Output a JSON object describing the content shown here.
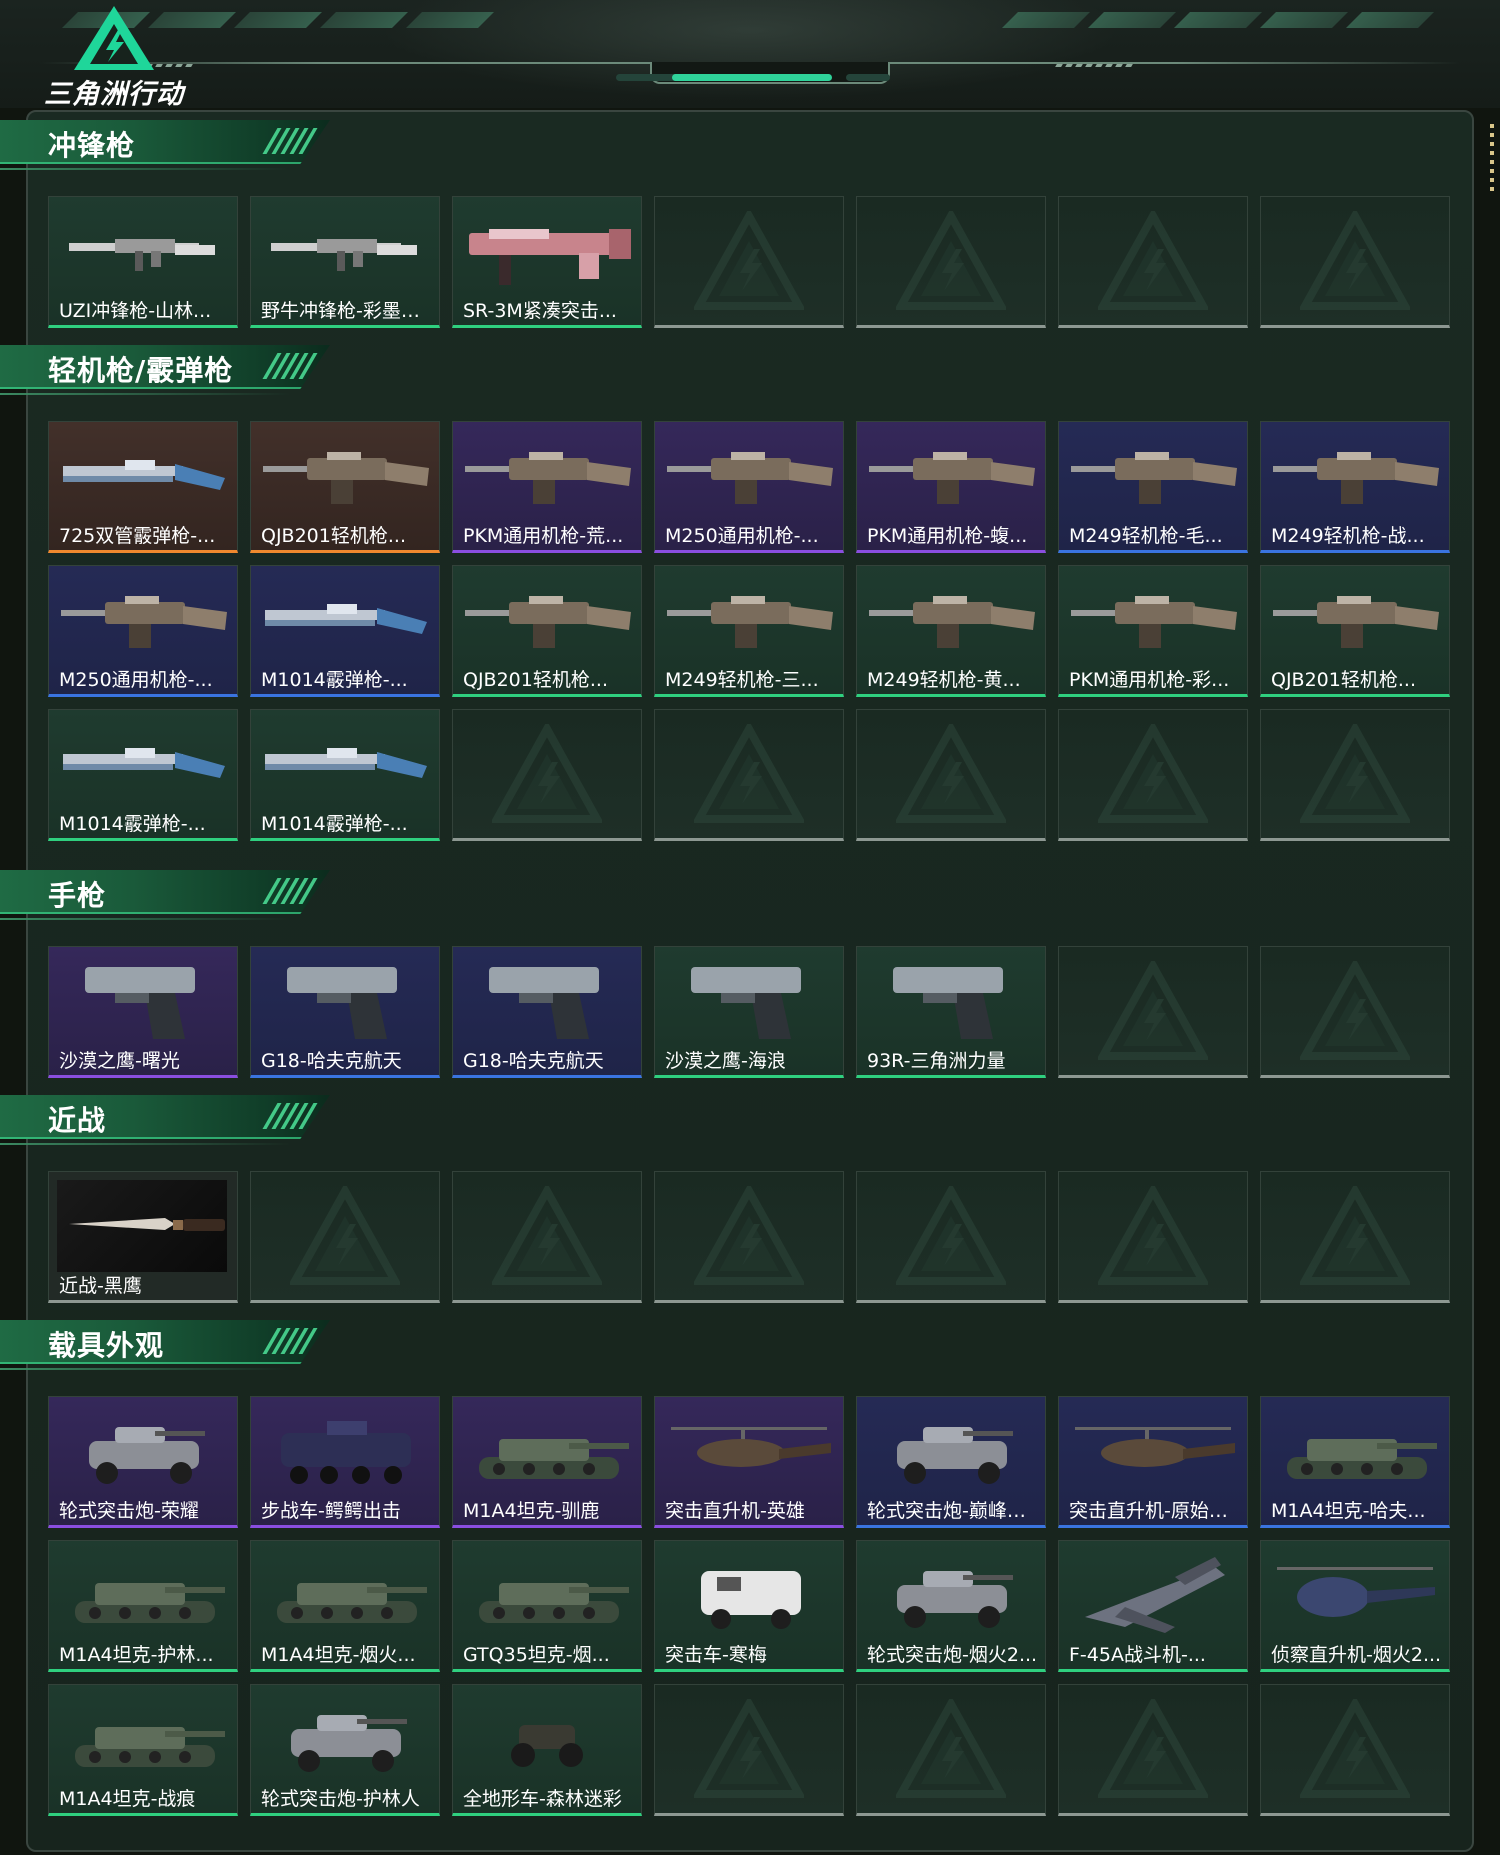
{
  "app": {
    "logo_text": "三角洲行动"
  },
  "colors": {
    "green": "#2fd07f",
    "blue": "#3a74e0",
    "purple": "#8a4ee0",
    "orange": "#f0882e",
    "empty": "#8d9892"
  },
  "sections": [
    {
      "title": "冲锋枪",
      "items": [
        {
          "label": "UZI冲锋枪-山林...",
          "rarity": "green",
          "kind": "smg"
        },
        {
          "label": "野牛冲锋枪-彩墨喷...",
          "rarity": "green",
          "kind": "smg"
        },
        {
          "label": "SR-3M紧凑突击...",
          "rarity": "green",
          "kind": "rifle"
        },
        {
          "label": "",
          "rarity": "empty"
        },
        {
          "label": "",
          "rarity": "empty"
        },
        {
          "label": "",
          "rarity": "empty"
        },
        {
          "label": "",
          "rarity": "empty"
        }
      ]
    },
    {
      "title": "轻机枪/霰弹枪",
      "items": [
        {
          "label": "725双管霰弹枪-...",
          "rarity": "orange",
          "kind": "shotgun"
        },
        {
          "label": "QJB201轻机枪...",
          "rarity": "orange",
          "kind": "lmg"
        },
        {
          "label": "PKM通用机枪-荒...",
          "rarity": "purple",
          "kind": "lmg"
        },
        {
          "label": "M250通用机枪-...",
          "rarity": "purple",
          "kind": "lmg"
        },
        {
          "label": "PKM通用机枪-蝮...",
          "rarity": "purple",
          "kind": "lmg"
        },
        {
          "label": "M249轻机枪-毛...",
          "rarity": "blue",
          "kind": "lmg"
        },
        {
          "label": "M249轻机枪-战...",
          "rarity": "blue",
          "kind": "lmg"
        },
        {
          "label": "M250通用机枪-...",
          "rarity": "blue",
          "kind": "lmg"
        },
        {
          "label": "M1014霰弹枪-...",
          "rarity": "blue",
          "kind": "shotgun"
        },
        {
          "label": "QJB201轻机枪...",
          "rarity": "green",
          "kind": "lmg"
        },
        {
          "label": "M249轻机枪-三...",
          "rarity": "green",
          "kind": "lmg"
        },
        {
          "label": "M249轻机枪-黄...",
          "rarity": "green",
          "kind": "lmg"
        },
        {
          "label": "PKM通用机枪-彩...",
          "rarity": "green",
          "kind": "lmg"
        },
        {
          "label": "QJB201轻机枪...",
          "rarity": "green",
          "kind": "lmg"
        },
        {
          "label": "M1014霰弹枪-...",
          "rarity": "green",
          "kind": "shotgun"
        },
        {
          "label": "M1014霰弹枪-...",
          "rarity": "green",
          "kind": "shotgun"
        },
        {
          "label": "",
          "rarity": "empty"
        },
        {
          "label": "",
          "rarity": "empty"
        },
        {
          "label": "",
          "rarity": "empty"
        },
        {
          "label": "",
          "rarity": "empty"
        },
        {
          "label": "",
          "rarity": "empty"
        }
      ]
    },
    {
      "title": "手枪",
      "items": [
        {
          "label": "沙漠之鹰-曙光",
          "rarity": "purple",
          "kind": "pistol"
        },
        {
          "label": "G18-哈夫克航天",
          "rarity": "blue",
          "kind": "pistol"
        },
        {
          "label": "G18-哈夫克航天",
          "rarity": "blue",
          "kind": "pistol"
        },
        {
          "label": "沙漠之鹰-海浪",
          "rarity": "green",
          "kind": "pistol"
        },
        {
          "label": "93R-三角洲力量",
          "rarity": "green",
          "kind": "pistol"
        },
        {
          "label": "",
          "rarity": "empty"
        },
        {
          "label": "",
          "rarity": "empty"
        }
      ]
    },
    {
      "title": "近战",
      "items": [
        {
          "label": "近战-黑鹰",
          "rarity": "melee",
          "kind": "knife"
        },
        {
          "label": "",
          "rarity": "empty"
        },
        {
          "label": "",
          "rarity": "empty"
        },
        {
          "label": "",
          "rarity": "empty"
        },
        {
          "label": "",
          "rarity": "empty"
        },
        {
          "label": "",
          "rarity": "empty"
        },
        {
          "label": "",
          "rarity": "empty"
        }
      ]
    },
    {
      "title": "载具外观",
      "items": [
        {
          "label": "轮式突击炮-荣耀",
          "rarity": "purple",
          "kind": "wheeled"
        },
        {
          "label": "步战车-鳄鳄出击",
          "rarity": "purple",
          "kind": "apc"
        },
        {
          "label": "M1A4坦克-驯鹿",
          "rarity": "purple",
          "kind": "tank"
        },
        {
          "label": "突击直升机-英雄",
          "rarity": "purple",
          "kind": "heli"
        },
        {
          "label": "轮式突击炮-巅峰竞...",
          "rarity": "blue",
          "kind": "wheeled"
        },
        {
          "label": "突击直升机-原始伪...",
          "rarity": "blue",
          "kind": "heli"
        },
        {
          "label": "M1A4坦克-哈夫...",
          "rarity": "blue",
          "kind": "tank"
        },
        {
          "label": "M1A4坦克-护林...",
          "rarity": "green",
          "kind": "tank"
        },
        {
          "label": "M1A4坦克-烟火...",
          "rarity": "green",
          "kind": "tank"
        },
        {
          "label": "GTQ35坦克-烟...",
          "rarity": "green",
          "kind": "tank"
        },
        {
          "label": "突击车-寒梅",
          "rarity": "green",
          "kind": "truck"
        },
        {
          "label": "轮式突击炮-烟火2...",
          "rarity": "green",
          "kind": "wheeled"
        },
        {
          "label": "F-45A战斗机-...",
          "rarity": "green",
          "kind": "jet"
        },
        {
          "label": "侦察直升机-烟火2...",
          "rarity": "green",
          "kind": "heli2"
        },
        {
          "label": "M1A4坦克-战痕",
          "rarity": "green",
          "kind": "tank"
        },
        {
          "label": "轮式突击炮-护林人",
          "rarity": "green",
          "kind": "wheeled"
        },
        {
          "label": "全地形车-森林迷彩",
          "rarity": "green",
          "kind": "atv"
        },
        {
          "label": "",
          "rarity": "empty"
        },
        {
          "label": "",
          "rarity": "empty"
        },
        {
          "label": "",
          "rarity": "empty"
        },
        {
          "label": "",
          "rarity": "empty"
        }
      ]
    }
  ]
}
